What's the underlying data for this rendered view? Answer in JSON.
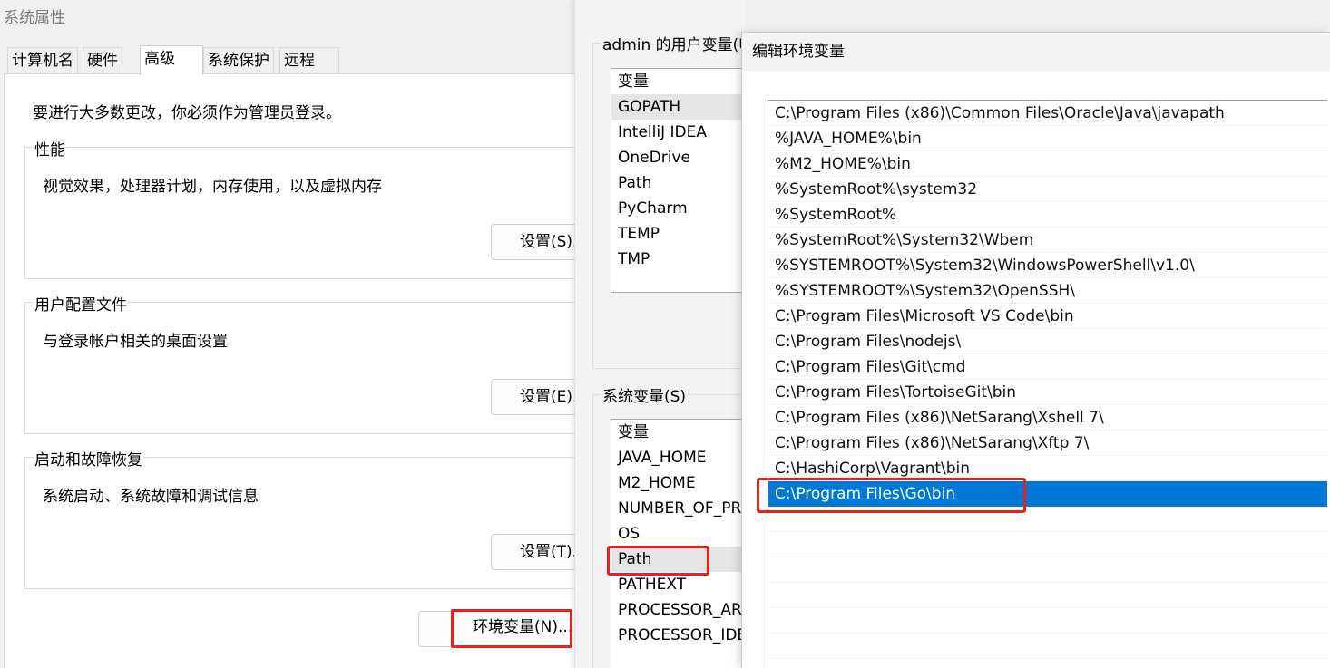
{
  "system_properties": {
    "title": "系统属性",
    "tabs": [
      "计算机名",
      "硬件",
      "高级",
      "系统保护",
      "远程"
    ],
    "active_tab": "高级",
    "intro": "要进行大多数更改，你必须作为管理员登录。",
    "performance": {
      "legend": "性能",
      "desc": "视觉效果，处理器计划，内存使用，以及虚拟内存",
      "button": "设置(S)..."
    },
    "user_profiles": {
      "legend": "用户配置文件",
      "desc": "与登录帐户相关的桌面设置",
      "button": "设置(E)..."
    },
    "startup_recovery": {
      "legend": "启动和故障恢复",
      "desc": "系统启动、系统故障和调试信息",
      "button": "设置(T)..."
    },
    "env_button": "环境变量(N)..."
  },
  "environment_variables": {
    "user_group_label": "admin 的用户变量(U)",
    "user_vars": [
      "变量",
      "GOPATH",
      "IntelliJ IDEA",
      "OneDrive",
      "Path",
      "PyCharm",
      "TEMP",
      "TMP"
    ],
    "user_selected": "GOPATH",
    "system_group_label": "系统变量(S)",
    "system_vars": [
      "变量",
      "JAVA_HOME",
      "M2_HOME",
      "NUMBER_OF_PROCESSORS",
      "OS",
      "Path",
      "PATHEXT",
      "PROCESSOR_ARCHITECTURE",
      "PROCESSOR_IDENTIFIER"
    ],
    "system_selected": "Path"
  },
  "edit_env_var": {
    "title": "编辑环境变量",
    "paths": [
      "C:\\Program Files (x86)\\Common Files\\Oracle\\Java\\javapath",
      "%JAVA_HOME%\\bin",
      "%M2_HOME%\\bin",
      "%SystemRoot%\\system32",
      "%SystemRoot%",
      "%SystemRoot%\\System32\\Wbem",
      "%SYSTEMROOT%\\System32\\WindowsPowerShell\\v1.0\\",
      "%SYSTEMROOT%\\System32\\OpenSSH\\",
      "C:\\Program Files\\Microsoft VS Code\\bin",
      "C:\\Program Files\\nodejs\\",
      "C:\\Program Files\\Git\\cmd",
      "C:\\Program Files\\TortoiseGit\\bin",
      "C:\\Program Files (x86)\\NetSarang\\Xshell 7\\",
      "C:\\Program Files (x86)\\NetSarang\\Xftp 7\\",
      "C:\\HashiCorp\\Vagrant\\bin",
      "C:\\Program Files\\Go\\bin",
      "",
      "",
      "",
      "",
      "",
      ""
    ],
    "selected_index": 15
  },
  "colors": {
    "selection": "#0078d7",
    "highlight_box": "#e8221b"
  }
}
